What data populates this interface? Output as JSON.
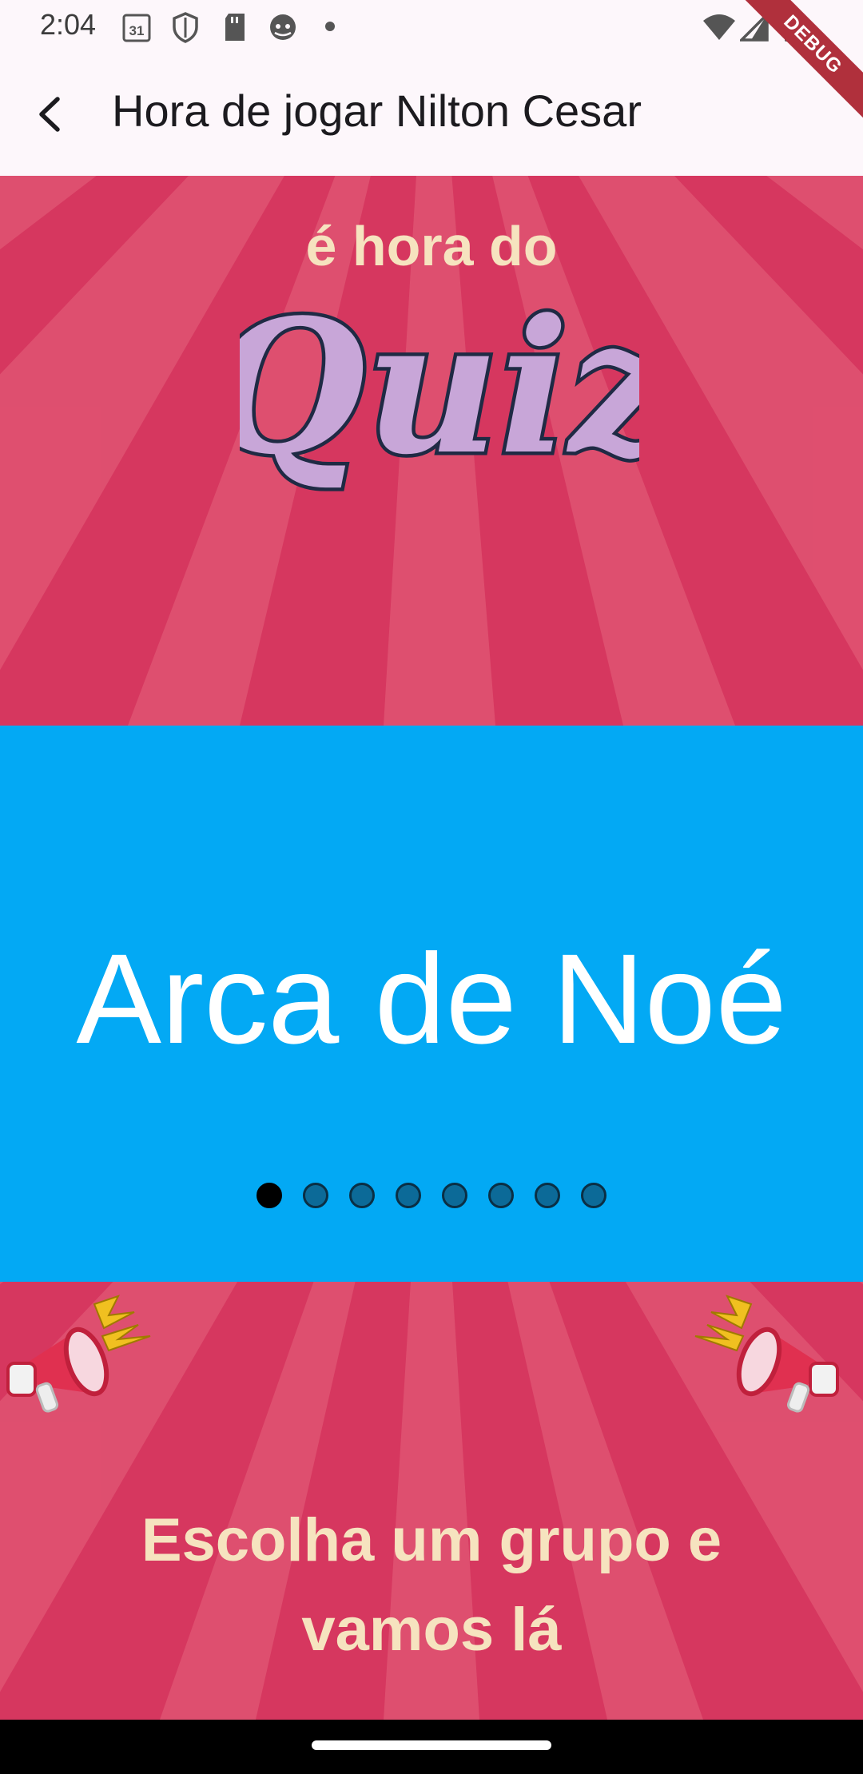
{
  "status_bar": {
    "time": "2:04",
    "calendar_day": "31",
    "debug_label": "DEBUG"
  },
  "app_bar": {
    "back_icon": "chevron-left-icon",
    "title": "Hora de jogar Nilton Cesar"
  },
  "header_art": {
    "subtitle": "é hora do",
    "logo_text": "Quiz"
  },
  "carousel": {
    "current_item": "Arca de Noé",
    "page_count": 8,
    "active_index": 0
  },
  "footer_art": {
    "megaphone_icon": "megaphone-icon",
    "cta_line1": "Escolha um grupo e",
    "cta_line2": "vamos lá"
  },
  "colors": {
    "pink": "#d6375f",
    "blue": "#03a9f4",
    "cream": "#f6e3bf",
    "quiz_lilac": "#c8a6d8"
  }
}
